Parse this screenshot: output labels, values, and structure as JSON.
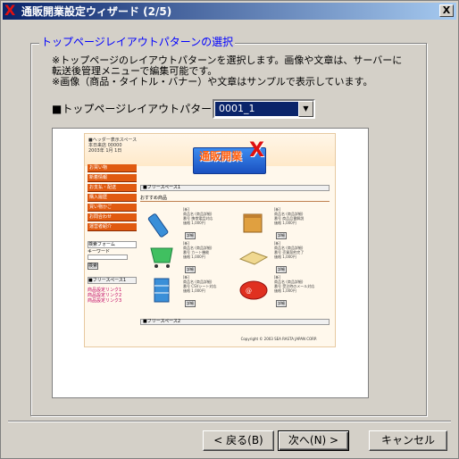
{
  "window": {
    "title": "通販開業設定ウィザード (2/5)",
    "close_label": "X"
  },
  "section": {
    "title": "トップページレイアウトパターンの選択"
  },
  "description": [
    "※トップページのレイアウトパターンを選択します。画像や文章は、サーバーに",
    "転送後管理メニューで編集可能です。",
    "※画像（商品・タイトル・バナー）や文章はサンプルで表示しています。"
  ],
  "pattern": {
    "label": "■トップページレイアウトパターン",
    "selected": "0001_1"
  },
  "preview": {
    "header_text": "■ヘッダー表示スペース",
    "visit_text": "本日来店 00000",
    "date_text": "2003年 1月 1日",
    "logo_text": "通販開業",
    "logo_x": "X",
    "menu": [
      "お買い物",
      "新着情報",
      "お支払・配送",
      "購入履歴",
      "買い物かご",
      "お問合わせ",
      "運営者紹介"
    ],
    "search_label": "検索フォーム",
    "keyword_label": "キーワード",
    "search_button": "検索",
    "free_space_left": "■フリースペース1",
    "links": [
      "商品設定リンク1",
      "商品設定リンク2",
      "商品設定リンク3"
    ],
    "free_space_top": "■フリースペース1",
    "osusume": "おすすめ商品",
    "products": [
      {
        "lines": [
          "[新]",
          "商品名 (商品詳細)",
          "番号 携帯電話対応",
          "価格 1,000円"
        ],
        "btn": "詳細"
      },
      {
        "lines": [
          "[新]",
          "商品名 (商品詳細)",
          "番号 商品品番解説",
          "価格 1,000円"
        ],
        "btn": "詳細"
      },
      {
        "lines": [
          "[新]",
          "商品名 (商品詳細)",
          "番号 カート機能",
          "価格 1,000円"
        ],
        "btn": "詳細"
      },
      {
        "lines": [
          "[新]",
          "商品名 (商品詳細)",
          "番号 売買契約完了",
          "価格 1,000円"
        ],
        "btn": "詳細"
      },
      {
        "lines": [
          "[新]",
          "商品名 (商品詳細)",
          "番号 CSVシート対応",
          "価格 1,000円"
        ],
        "btn": "詳細"
      },
      {
        "lines": [
          "[新]",
          "商品名 (商品詳細)",
          "番号 受注時のメール対応",
          "価格 1,000円"
        ],
        "btn": "詳細"
      }
    ],
    "free_space_bottom": "■フリースペース2",
    "copyright": "Copyright © 2003 SEA RASTA JAPAN CORP."
  },
  "buttons": {
    "back": "< 戻る(B)",
    "next": "次へ(N) >",
    "cancel": "キャンセル"
  }
}
